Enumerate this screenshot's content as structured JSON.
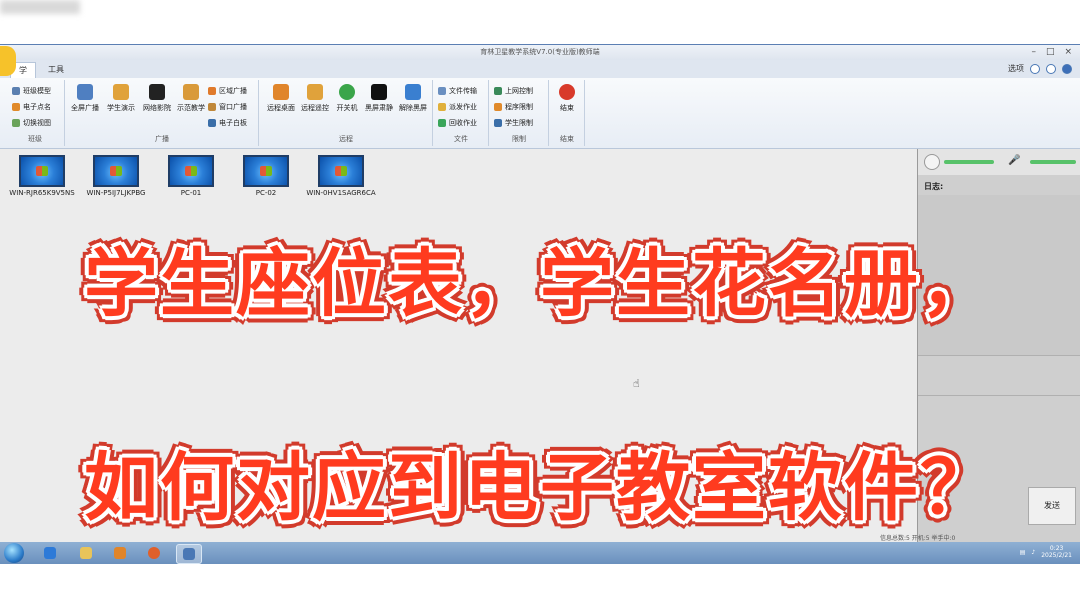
{
  "app": {
    "title": "育林卫星教学系统V7.0(专业版)教师端",
    "window_controls": [
      "–",
      "□",
      "×"
    ]
  },
  "tabs": [
    {
      "label": "学",
      "active": true
    },
    {
      "label": "工具",
      "active": false
    }
  ],
  "options_label": "选项",
  "ribbon": {
    "groups": [
      {
        "label": "班级",
        "items": [
          "班级模型",
          "电子点名",
          "切换视图"
        ]
      },
      {
        "label": "广播",
        "big_items": [
          "全屏广播",
          "学生演示",
          "网络影院",
          "示范教学"
        ],
        "small_items": [
          "区域广播",
          "窗口广播",
          "电子白板"
        ]
      },
      {
        "label": "远程",
        "big_items": [
          "远程桌面",
          "远程遥控",
          "开关机",
          "黑屏肃静",
          "解除黑屏"
        ]
      },
      {
        "label": "文件",
        "items": [
          "文件传输",
          "派发作业",
          "回收作业"
        ]
      },
      {
        "label": "限制",
        "items": [
          "上网控制",
          "程序限制",
          "学生限制"
        ]
      },
      {
        "label": "结束",
        "big_items": [
          "结束"
        ]
      }
    ]
  },
  "students": [
    {
      "name": "WIN-RJR65K9V5NS"
    },
    {
      "name": "WIN-P5IJ7LJKPBG"
    },
    {
      "name": "PC-01"
    },
    {
      "name": "PC-02"
    },
    {
      "name": "WIN-0HV1SAGR6CA"
    }
  ],
  "right_panel": {
    "log_label": "日志:",
    "send_button": "发送"
  },
  "status": {
    "text": "信息总数:5  开机:5  举手中:0",
    "time": "0:23",
    "date": "2025/2/21"
  },
  "overlay": {
    "line1": "学生座位表，学生花名册，",
    "line2": "如何对应到电子教室软件？"
  },
  "colors": {
    "overlay_text": "#ff3b1f",
    "overlay_outline": "#d23b2c",
    "taskbar": "#6a90bd",
    "ribbon_bg": "#e7edf5"
  }
}
